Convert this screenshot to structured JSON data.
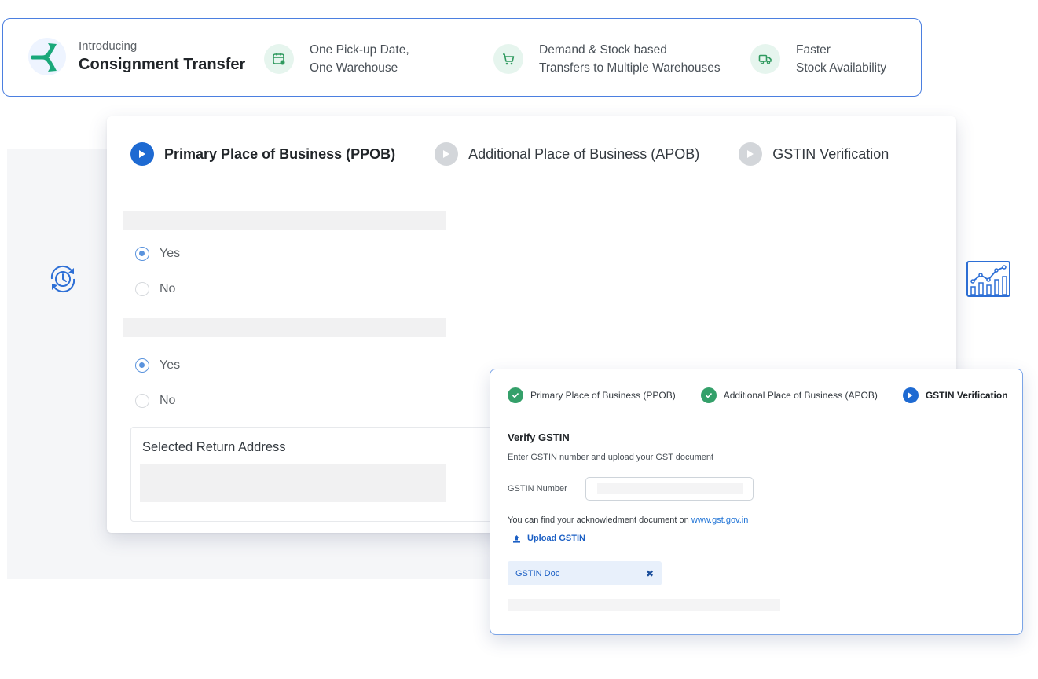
{
  "banner": {
    "intro": "Introducing",
    "title": "Consignment Transfer",
    "features": [
      {
        "icon": "calendar-icon",
        "line1": "One Pick-up Date,",
        "line2": "One Warehouse"
      },
      {
        "icon": "cart-icon",
        "line1": "Demand & Stock based",
        "line2": "Transfers to Multiple Warehouses"
      },
      {
        "icon": "truck-icon",
        "line1": "Faster",
        "line2": "Stock Availability"
      }
    ]
  },
  "main": {
    "steps": [
      {
        "label": "Primary Place of Business (PPOB)",
        "state": "active"
      },
      {
        "label": "Additional Place of Business (APOB)",
        "state": "inactive"
      },
      {
        "label": "GSTIN Verification",
        "state": "inactive"
      }
    ],
    "question1": {
      "options": [
        {
          "label": "Yes",
          "selected": true
        },
        {
          "label": "No",
          "selected": false
        }
      ]
    },
    "question2": {
      "options": [
        {
          "label": "Yes",
          "selected": true
        },
        {
          "label": "No",
          "selected": false
        }
      ]
    },
    "return_address_title": "Selected Return Address"
  },
  "side_icons": {
    "left": "clock-refresh-icon",
    "right": "analytics-chart-icon"
  },
  "gstin": {
    "steps": [
      {
        "label": "Primary Place of Business (PPOB)",
        "state": "done"
      },
      {
        "label": "Additional Place of Business (APOB)",
        "state": "done"
      },
      {
        "label": "GSTIN Verification",
        "state": "active"
      }
    ],
    "title": "Verify GSTIN",
    "subtitle": "Enter GSTIN number and upload your GST document",
    "field_label": "GSTIN Number",
    "field_value": "",
    "note_prefix": "You can find your acknowledment document on ",
    "note_link": "www.gst.gov.in",
    "upload_label": "Upload GSTIN",
    "doc_label": "GSTIN Doc",
    "doc_close": "✖"
  },
  "colors": {
    "accent": "#1e6ad2",
    "success": "#34a06a",
    "banner_border": "#4b7fe0",
    "feature_green": "#2f9a5f"
  }
}
